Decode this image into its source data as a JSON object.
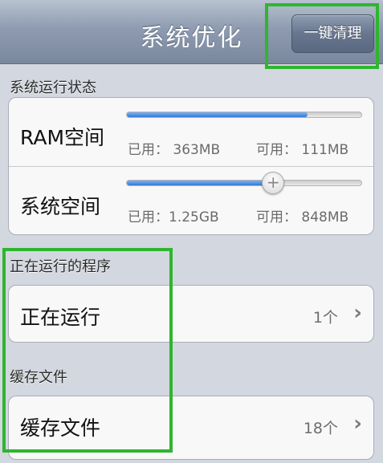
{
  "nav": {
    "title": "系统优化",
    "clean_button": "一键清理"
  },
  "system_status": {
    "header": "系统运行状态",
    "ram": {
      "label": "RAM空间",
      "used": "已用： 363MB",
      "free": "可用： 111MB",
      "fraction_used": 0.77
    },
    "storage": {
      "label": "系统空间",
      "used": "已用：1.25GB",
      "free": "可用： 848MB",
      "fraction_used": 0.62
    }
  },
  "running": {
    "header": "正在运行的程序",
    "row_label": "正在运行",
    "count": "1个"
  },
  "cache": {
    "header": "缓存文件",
    "row_label": "缓存文件",
    "count": "18个"
  },
  "icons": {
    "chevron": "chevron-right-icon",
    "knob": "slider-knob-icon"
  },
  "colors": {
    "highlight": "#2fb52f",
    "progress": "#2f7ad8"
  }
}
